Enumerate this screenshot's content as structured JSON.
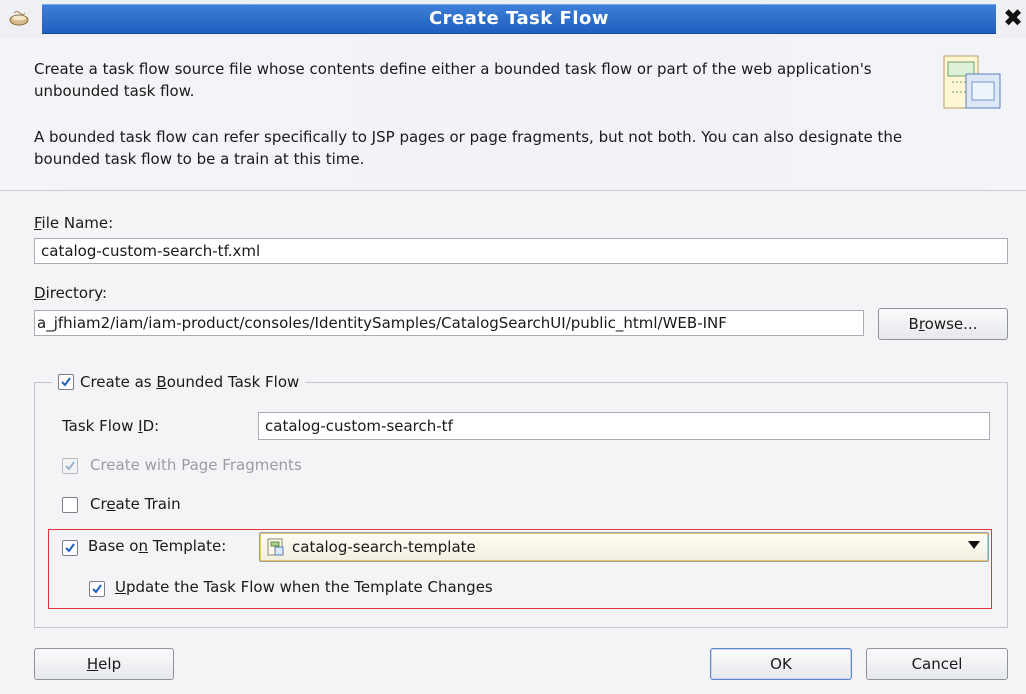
{
  "dialog": {
    "title": "Create Task Flow",
    "close_glyph": "✖"
  },
  "header": {
    "description_1": "Create a task flow source file whose contents define either a bounded task flow or part of the web application's unbounded task flow.",
    "description_2": "A bounded task flow can refer specifically to JSP pages or page fragments, but not both.  You can also designate the bounded task flow to be a train at this time."
  },
  "file_name": {
    "label_mnemonic": "F",
    "label_rest": "ile Name:",
    "value": "catalog-custom-search-tf.xml"
  },
  "directory": {
    "label_mnemonic": "D",
    "label_rest": "irectory:",
    "value": "a_jfhiam2/iam/iam-product/consoles/IdentitySamples/CatalogSearchUI/public_html/WEB-INF",
    "browse_pre": "B",
    "browse_mnemonic": "r",
    "browse_post": "owse..."
  },
  "bounded": {
    "label_pre": "Create as ",
    "label_mnemonic": "B",
    "label_post": "ounded Task Flow",
    "checked": true
  },
  "task_flow_id": {
    "label_pre": "Task Flow ",
    "label_mnemonic": "I",
    "label_post": "D:",
    "value": "catalog-custom-search-tf"
  },
  "page_fragments": {
    "label_pre": "Create with Pa",
    "label_mnemonic": "g",
    "label_post": "e Fragments",
    "checked": true,
    "enabled": false
  },
  "create_train": {
    "label_pre": "Cr",
    "label_mnemonic": "e",
    "label_post": "ate Train",
    "checked": false
  },
  "base_on_template": {
    "label_pre": "Base o",
    "label_mnemonic": "n",
    "label_post": " Template:",
    "checked": true,
    "selected_value": "catalog-search-template"
  },
  "update_on_change": {
    "label_mnemonic": "U",
    "label_rest": "pdate the Task Flow when the Template Changes",
    "checked": true
  },
  "buttons": {
    "help_mnemonic": "H",
    "help_rest": "elp",
    "ok": "OK",
    "cancel": "Cancel"
  },
  "colors": {
    "title_band": "#2f6fcf",
    "highlight_border": "#e4353a",
    "checkbox_mark": "#1f5fbf"
  },
  "icons": {
    "app": "coffee-cup-icon",
    "header": "task-flow-diagram-icon",
    "combo": "template-file-icon",
    "close": "close-icon"
  }
}
